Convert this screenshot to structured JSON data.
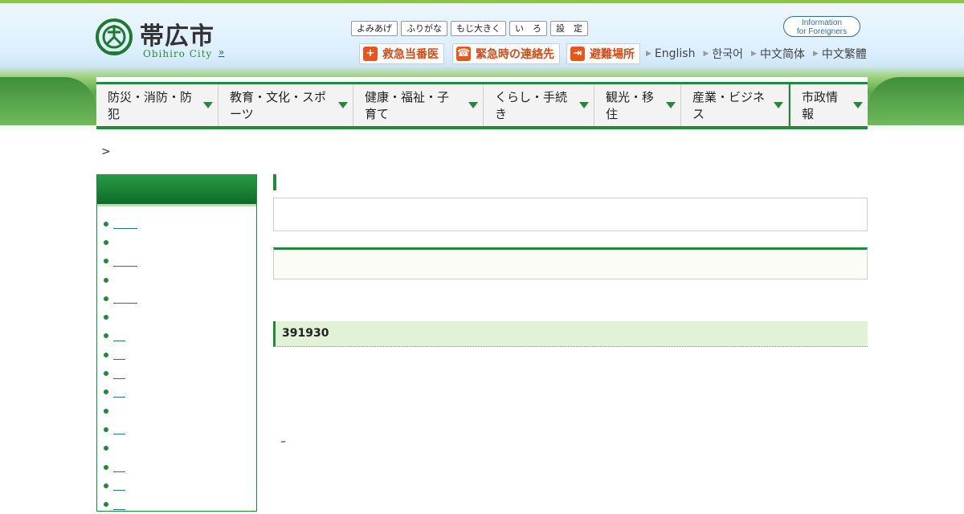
{
  "header": {
    "logo_title": "帯広市",
    "logo_sub": "Obihiro City",
    "logo_more": "»",
    "util_buttons": [
      "よみあげ",
      "ふりがな",
      "もじ大きく",
      "い　ろ",
      "設　定"
    ],
    "info_foreigners_line1": "Information",
    "info_foreigners_line2": "for Foreigners",
    "emergency": [
      {
        "label": "救急当番医",
        "icon": "+"
      },
      {
        "label": "緊急時の連絡先",
        "icon": "☎"
      },
      {
        "label": "避難場所",
        "icon": "⇥"
      }
    ],
    "languages": [
      "English",
      "한국어",
      "中文简体",
      "中文繁體"
    ]
  },
  "global_nav": [
    "防災・消防・防犯",
    "教育・文化・スポーツ",
    "健康・福祉・子育て",
    "くらし・手続き",
    "観光・移住",
    "産業・ビジネス",
    "市政情報"
  ],
  "breadcrumb": ">",
  "main": {
    "section_id": "391930",
    "dash": "–"
  },
  "colors": {
    "brand_green": "#1f8a3a",
    "emergency_orange": "#e5571d",
    "link_blue": "#1f6fb2"
  }
}
